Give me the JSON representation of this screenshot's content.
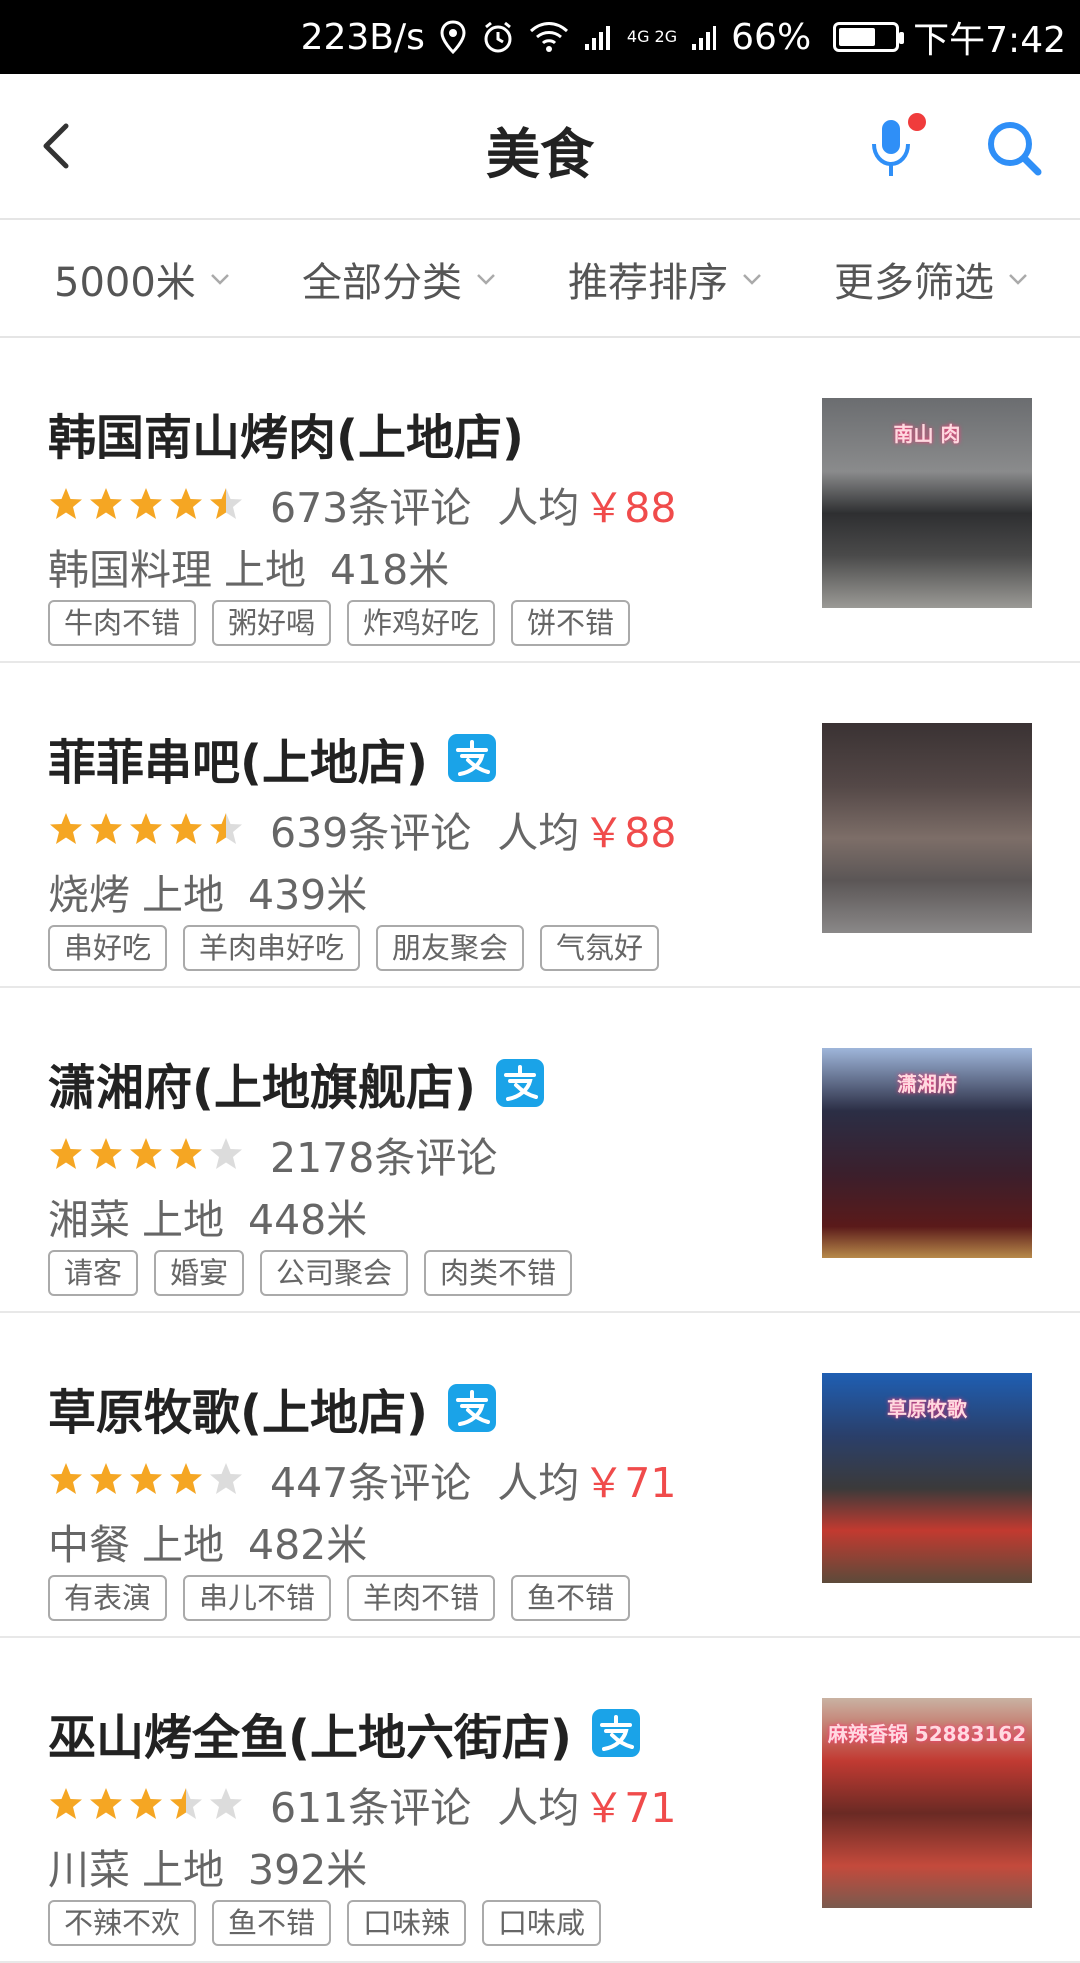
{
  "status_bar": {
    "speed": "223B/s",
    "network": "4G 2G",
    "battery_percent": "66%",
    "battery_level": 0.66,
    "time": "下午7:42"
  },
  "header": {
    "title": "美食"
  },
  "filters": [
    {
      "label": "5000米"
    },
    {
      "label": "全部分类"
    },
    {
      "label": "推荐排序"
    },
    {
      "label": "更多筛选"
    }
  ],
  "colors": {
    "accent_blue": "#2f8ff7",
    "star_orange": "#f5a623",
    "price_red": "#f04b4b",
    "alipay_blue": "#1aa3e8"
  },
  "restaurants": [
    {
      "name": "韩国南山烤肉(上地店)",
      "alipay": false,
      "rating": 4.5,
      "reviews": "673条评论",
      "price_label": "人均",
      "price": "￥88",
      "category": "韩国料理",
      "area": "上地",
      "distance": "418米",
      "tags": [
        "牛肉不错",
        "粥好喝",
        "炸鸡好吃",
        "饼不错"
      ],
      "image_text": "南山 肉"
    },
    {
      "name": "菲菲串吧(上地店)",
      "alipay": true,
      "rating": 4.5,
      "reviews": "639条评论",
      "price_label": "人均",
      "price": "￥88",
      "category": "烧烤",
      "area": "上地",
      "distance": "439米",
      "tags": [
        "串好吃",
        "羊肉串好吃",
        "朋友聚会",
        "气氛好"
      ],
      "image_text": ""
    },
    {
      "name": "潇湘府(上地旗舰店)",
      "alipay": true,
      "rating": 4,
      "reviews": "2178条评论",
      "price_label": "",
      "price": "",
      "category": "湘菜",
      "area": "上地",
      "distance": "448米",
      "tags": [
        "请客",
        "婚宴",
        "公司聚会",
        "肉类不错"
      ],
      "image_text": "潇湘府"
    },
    {
      "name": "草原牧歌(上地店)",
      "alipay": true,
      "rating": 4,
      "reviews": "447条评论",
      "price_label": "人均",
      "price": "￥71",
      "category": "中餐",
      "area": "上地",
      "distance": "482米",
      "tags": [
        "有表演",
        "串儿不错",
        "羊肉不错",
        "鱼不错"
      ],
      "image_text": "草原牧歌"
    },
    {
      "name": "巫山烤全鱼(上地六街店)",
      "alipay": true,
      "rating": 3.5,
      "reviews": "611条评论",
      "price_label": "人均",
      "price": "￥71",
      "category": "川菜",
      "area": "上地",
      "distance": "392米",
      "tags": [
        "不辣不欢",
        "鱼不错",
        "口味辣",
        "口味咸"
      ],
      "image_text": "麻辣香锅 52883162"
    }
  ]
}
